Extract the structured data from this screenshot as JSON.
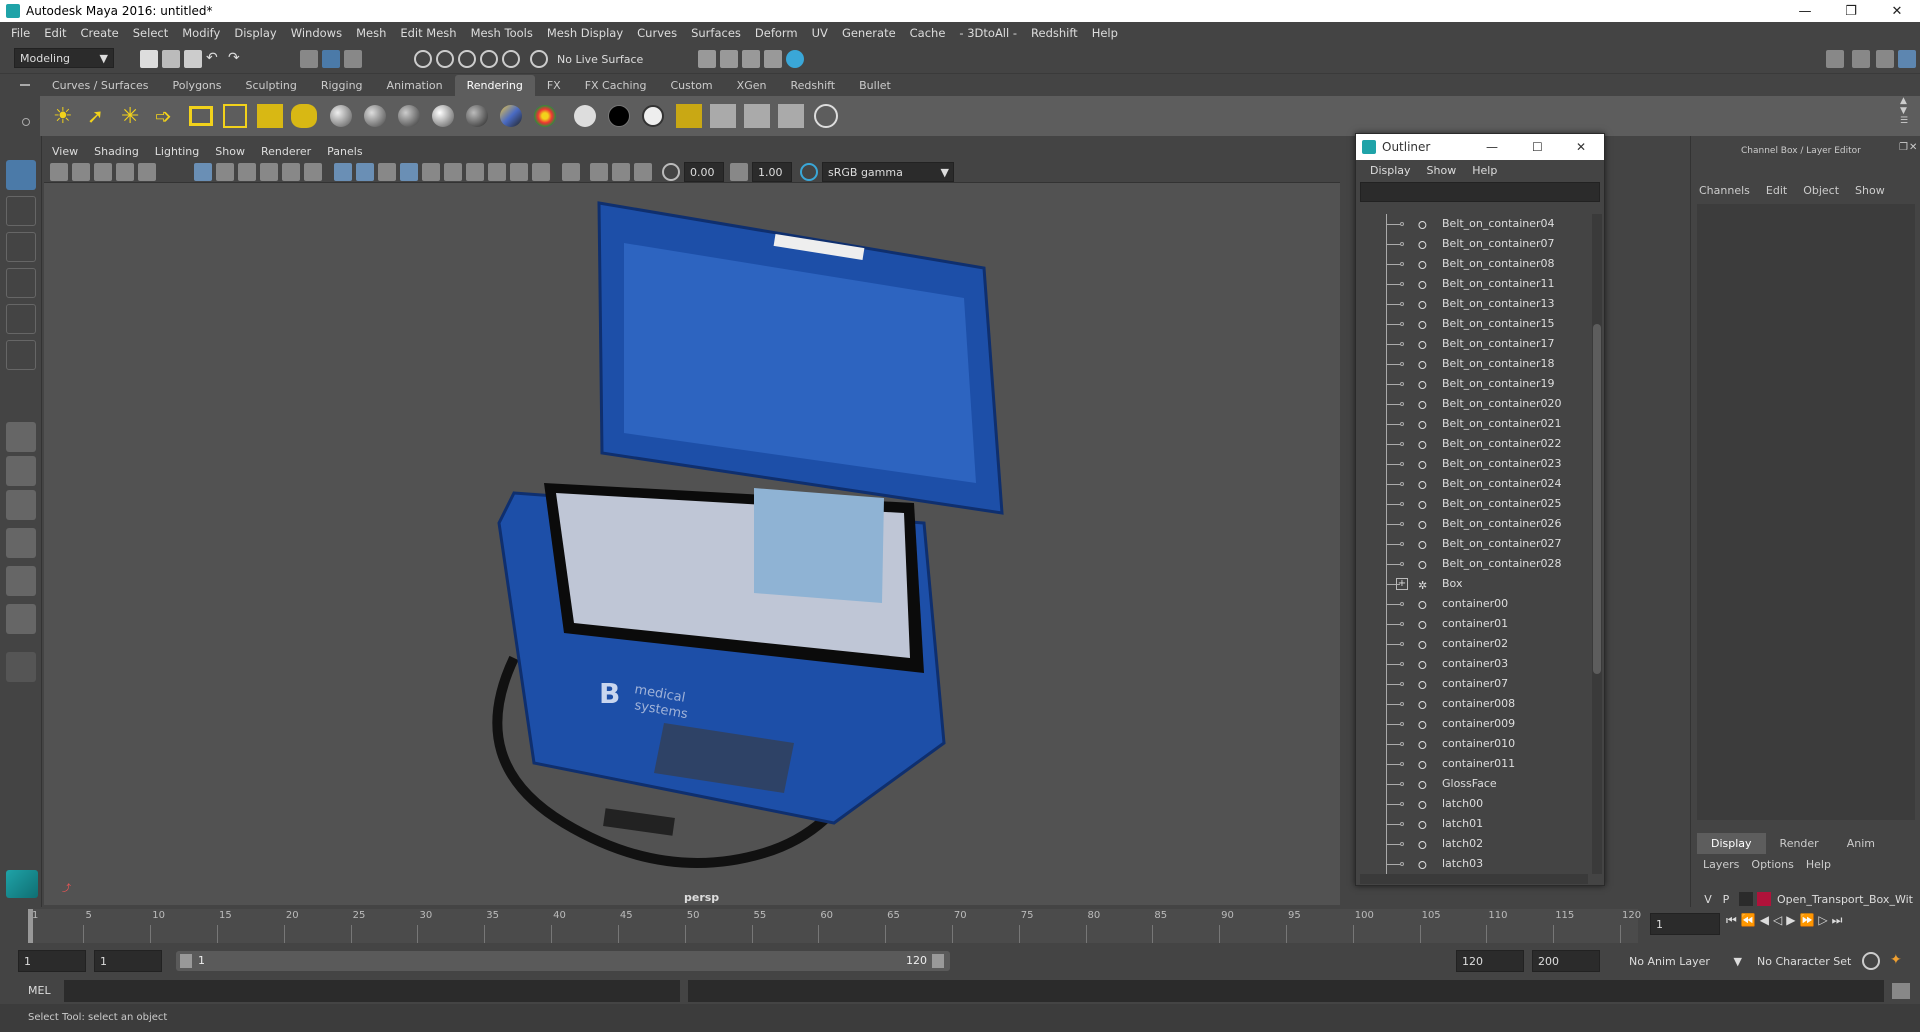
{
  "window": {
    "title": "Autodesk Maya 2016: untitled*"
  },
  "menubar": [
    "File",
    "Edit",
    "Create",
    "Select",
    "Modify",
    "Display",
    "Windows",
    "Mesh",
    "Edit Mesh",
    "Mesh Tools",
    "Mesh Display",
    "Curves",
    "Surfaces",
    "Deform",
    "UV",
    "Generate",
    "Cache",
    "- 3DtoAll -",
    "Redshift",
    "Help"
  ],
  "statusline": {
    "menu_set": "Modeling",
    "live_surface": "No Live Surface"
  },
  "shelf": {
    "tabs": [
      "Curves / Surfaces",
      "Polygons",
      "Sculpting",
      "Rigging",
      "Animation",
      "Rendering",
      "FX",
      "FX Caching",
      "Custom",
      "XGen",
      "Redshift",
      "Bullet"
    ],
    "active_tab": "Rendering"
  },
  "panel": {
    "menus": [
      "View",
      "Shading",
      "Lighting",
      "Show",
      "Renderer",
      "Panels"
    ],
    "exposure": "0.00",
    "gamma": "1.00",
    "color_space": "sRGB gamma",
    "camera": "persp"
  },
  "outliner": {
    "title": "Outliner",
    "menus": [
      "Display",
      "Show",
      "Help"
    ],
    "items": [
      {
        "label": "Belt_on_container04",
        "type": "mesh"
      },
      {
        "label": "Belt_on_container07",
        "type": "mesh"
      },
      {
        "label": "Belt_on_container08",
        "type": "mesh"
      },
      {
        "label": "Belt_on_container11",
        "type": "mesh"
      },
      {
        "label": "Belt_on_container13",
        "type": "mesh"
      },
      {
        "label": "Belt_on_container15",
        "type": "mesh"
      },
      {
        "label": "Belt_on_container17",
        "type": "mesh"
      },
      {
        "label": "Belt_on_container18",
        "type": "mesh"
      },
      {
        "label": "Belt_on_container19",
        "type": "mesh"
      },
      {
        "label": "Belt_on_container020",
        "type": "mesh"
      },
      {
        "label": "Belt_on_container021",
        "type": "mesh"
      },
      {
        "label": "Belt_on_container022",
        "type": "mesh"
      },
      {
        "label": "Belt_on_container023",
        "type": "mesh"
      },
      {
        "label": "Belt_on_container024",
        "type": "mesh"
      },
      {
        "label": "Belt_on_container025",
        "type": "mesh"
      },
      {
        "label": "Belt_on_container026",
        "type": "mesh"
      },
      {
        "label": "Belt_on_container027",
        "type": "mesh"
      },
      {
        "label": "Belt_on_container028",
        "type": "mesh"
      },
      {
        "label": "Box",
        "type": "group"
      },
      {
        "label": "container00",
        "type": "mesh"
      },
      {
        "label": "container01",
        "type": "mesh"
      },
      {
        "label": "container02",
        "type": "mesh"
      },
      {
        "label": "container03",
        "type": "mesh"
      },
      {
        "label": "container07",
        "type": "mesh"
      },
      {
        "label": "container008",
        "type": "mesh"
      },
      {
        "label": "container009",
        "type": "mesh"
      },
      {
        "label": "container010",
        "type": "mesh"
      },
      {
        "label": "container011",
        "type": "mesh"
      },
      {
        "label": "GlossFace",
        "type": "mesh"
      },
      {
        "label": "latch00",
        "type": "mesh"
      },
      {
        "label": "latch01",
        "type": "mesh"
      },
      {
        "label": "latch02",
        "type": "mesh"
      },
      {
        "label": "latch03",
        "type": "mesh"
      }
    ]
  },
  "channelbox": {
    "title": "Channel Box / Layer Editor",
    "menus": [
      "Channels",
      "Edit",
      "Object",
      "Show"
    ],
    "layer_tabs": [
      "Display",
      "Render",
      "Anim"
    ],
    "active_layer_tab": "Display",
    "layer_menus": [
      "Layers",
      "Options",
      "Help"
    ],
    "layer": {
      "v": "V",
      "p": "P",
      "name": "Open_Transport_Box_Wit",
      "color": "#b0123a"
    }
  },
  "timeline": {
    "ticks": [
      "1",
      "5",
      "10",
      "15",
      "20",
      "25",
      "30",
      "35",
      "40",
      "45",
      "50",
      "55",
      "60",
      "65",
      "70",
      "75",
      "80",
      "85",
      "90",
      "95",
      "100",
      "105",
      "110",
      "115",
      "120"
    ],
    "current_frame": "1"
  },
  "range": {
    "start": "1",
    "playback_start": "1",
    "slider_start": "1",
    "slider_end": "120",
    "playback_end": "120",
    "end": "200",
    "anim_layer": "No Anim Layer",
    "character_set": "No Character Set"
  },
  "commandline": {
    "lang": "MEL"
  },
  "helpline": "Select Tool: select an object",
  "box_logo": {
    "letter": "B",
    "line1": "medical",
    "line2": "systems"
  }
}
